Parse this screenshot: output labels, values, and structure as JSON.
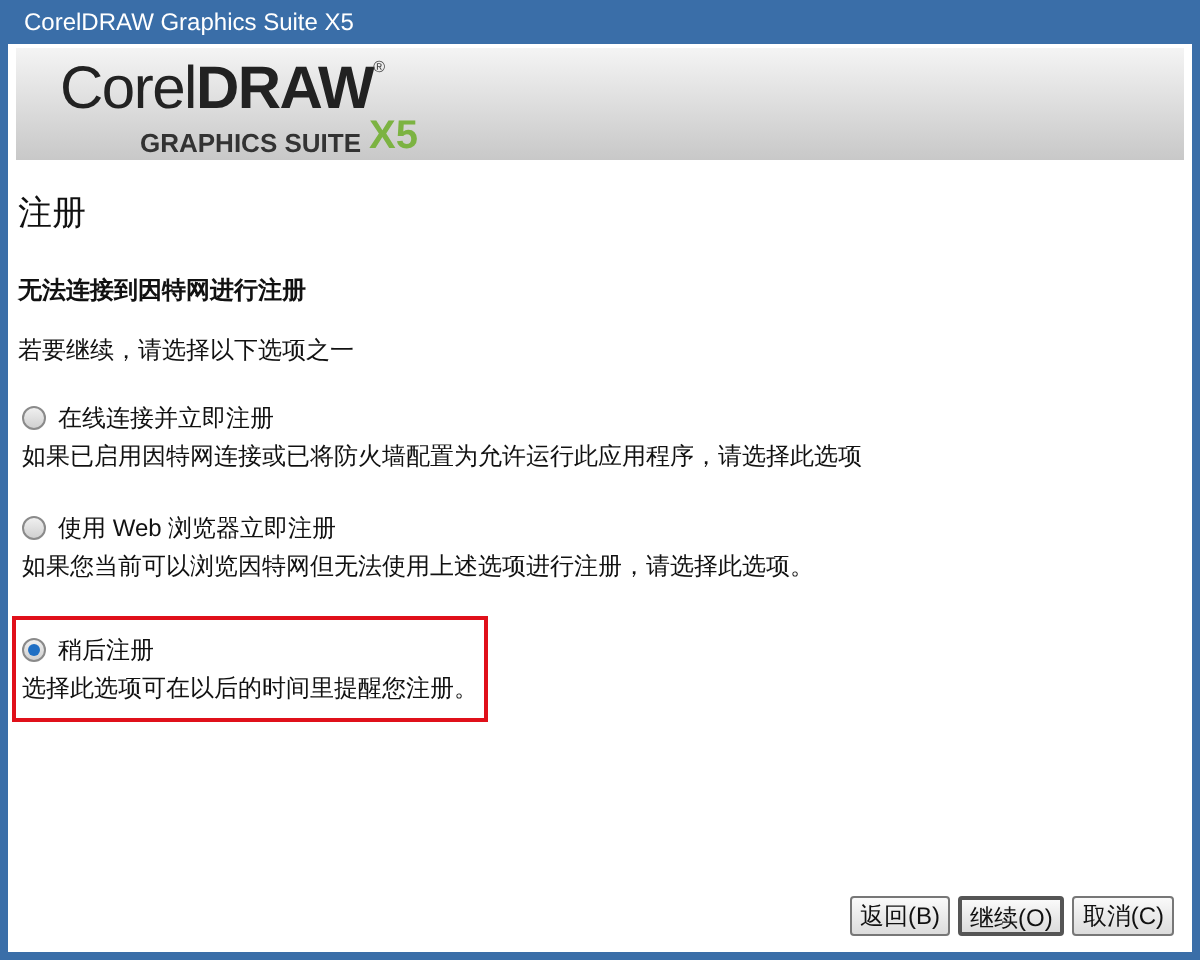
{
  "window": {
    "title": "CorelDRAW Graphics Suite X5"
  },
  "logo": {
    "name_light": "Corel",
    "name_bold": "DRAW",
    "mark": "®",
    "subtitle": "GRAPHICS SUITE",
    "version": "X5"
  },
  "heading": "注册",
  "subheading": "无法连接到因特网进行注册",
  "instruction": "若要继续，请选择以下选项之一",
  "options": [
    {
      "label": "在线连接并立即注册",
      "description": "如果已启用因特网连接或已将防火墙配置为允许运行此应用程序，请选择此选项",
      "selected": false,
      "highlighted": false
    },
    {
      "label": "使用 Web 浏览器立即注册",
      "description": "如果您当前可以浏览因特网但无法使用上述选项进行注册，请选择此选项。",
      "selected": false,
      "highlighted": false
    },
    {
      "label": "稍后注册",
      "description": "选择此选项可在以后的时间里提醒您注册。",
      "selected": true,
      "highlighted": true
    }
  ],
  "buttons": [
    {
      "label": "返回(B)",
      "default": false
    },
    {
      "label": "继续(O)",
      "default": true
    },
    {
      "label": "取消(C)",
      "default": false
    }
  ]
}
